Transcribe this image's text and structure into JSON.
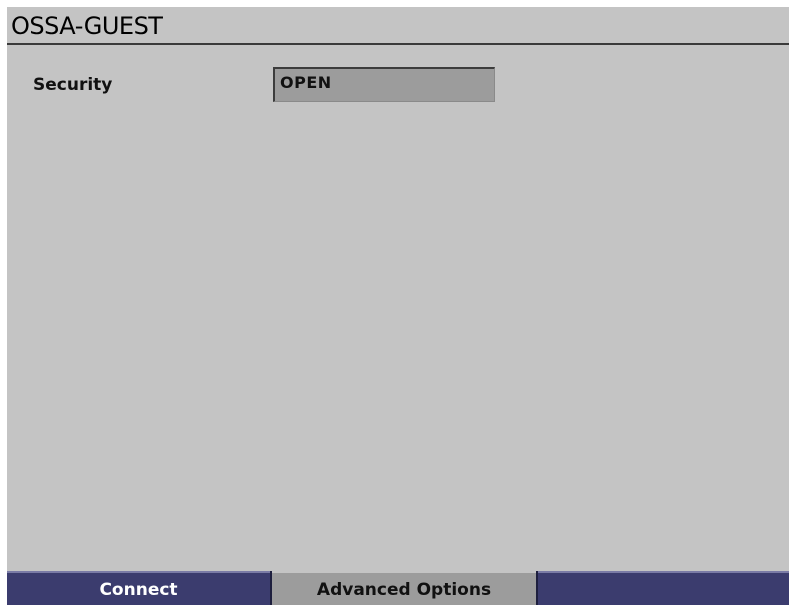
{
  "header": {
    "title": "OSSA-GUEST"
  },
  "settings": {
    "security_label": "Security",
    "security_value": "OPEN"
  },
  "bottom_tabs": [
    {
      "label": "Connect"
    },
    {
      "label": "Advanced Options"
    },
    {
      "label": ""
    }
  ],
  "colors": {
    "background": "#c4c4c4",
    "tab_bar": "#3b3c6e",
    "selected_field": "#9c9c9c"
  }
}
